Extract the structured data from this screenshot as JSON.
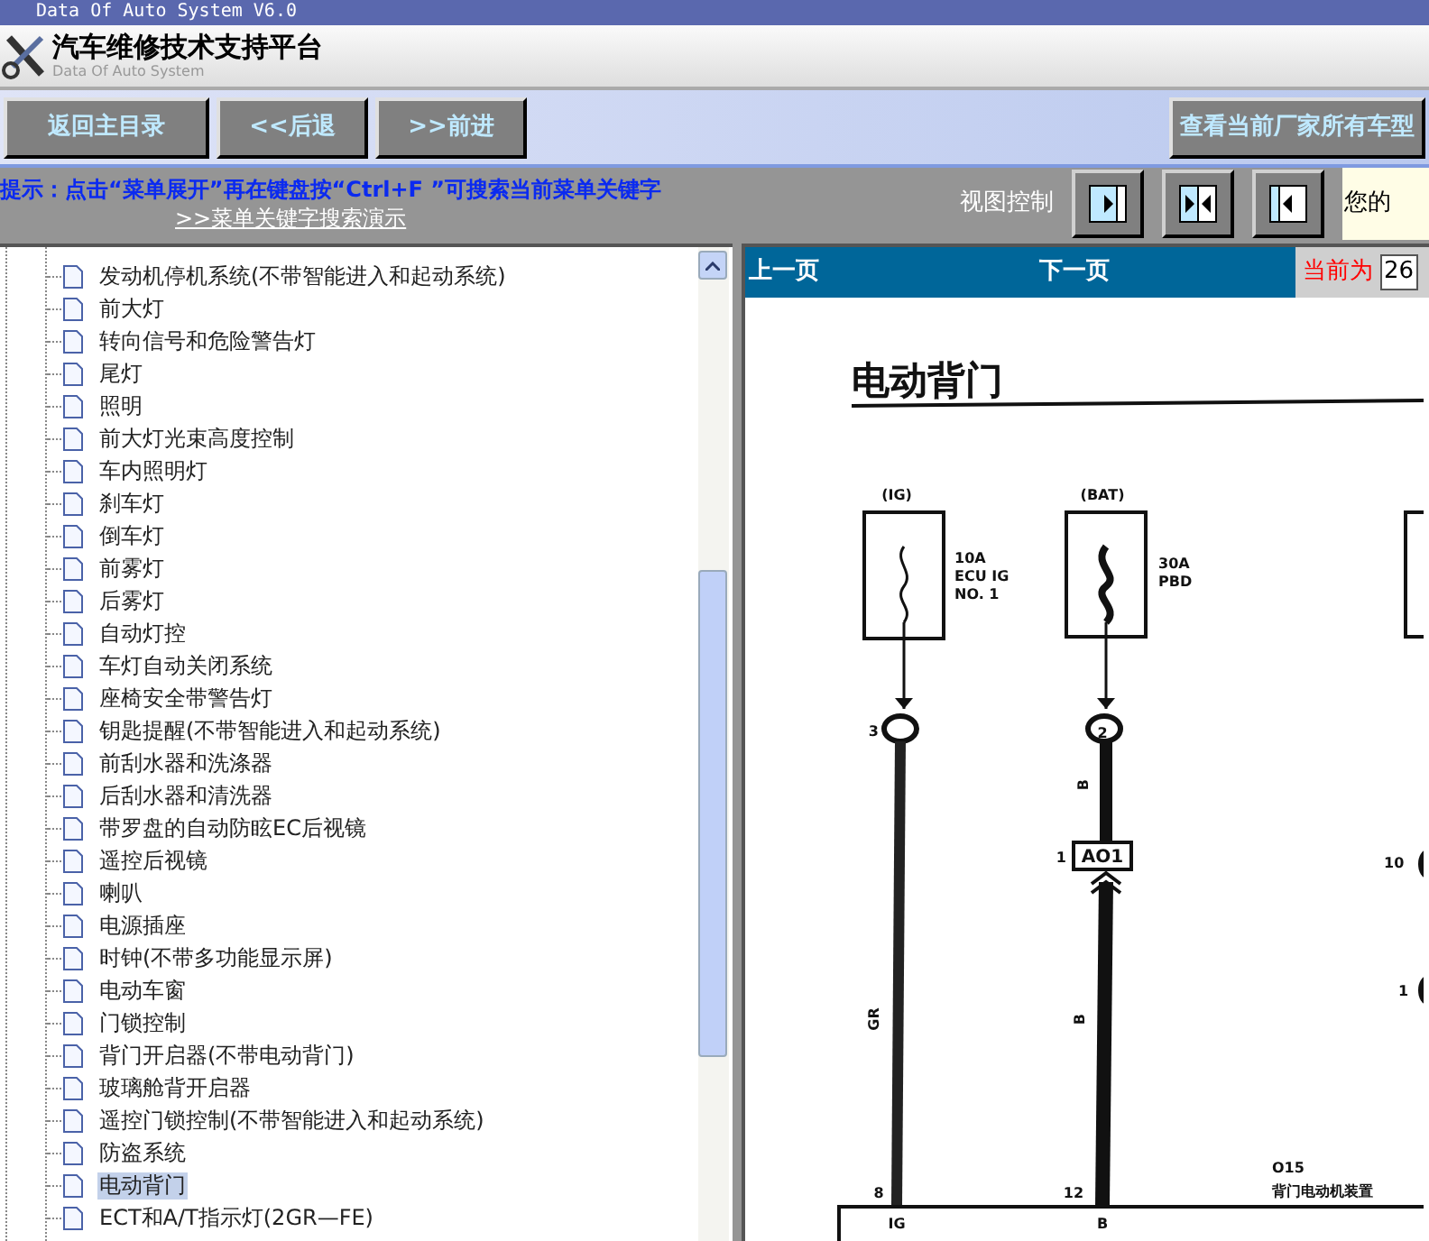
{
  "window": {
    "title": "Data Of Auto System V6.0"
  },
  "header": {
    "title": "汽车维修技术支持平台",
    "subtitle": "Data Of Auto System"
  },
  "nav_buttons": [
    "返回主目录",
    "<<后退",
    ">>前进"
  ],
  "models_button": "查看当前厂家所有车型",
  "hint": {
    "text": "提示：点击“菜单展开”再在键盘按“Ctrl+F ”可搜索当前菜单关键字",
    "link": ">>菜单关键字搜索演示"
  },
  "view_control": {
    "label": "视图控制",
    "buttons": [
      {
        "kind": "left"
      },
      {
        "kind": "split"
      },
      {
        "kind": "right"
      }
    ]
  },
  "user_box": "您的",
  "tree": [
    {
      "label": "发动机停机系统(不带智能进入和起动系统)",
      "selected": false
    },
    {
      "label": "前大灯",
      "selected": false
    },
    {
      "label": "转向信号和危险警告灯",
      "selected": false
    },
    {
      "label": "尾灯",
      "selected": false
    },
    {
      "label": "照明",
      "selected": false
    },
    {
      "label": "前大灯光束高度控制",
      "selected": false
    },
    {
      "label": "车内照明灯",
      "selected": false
    },
    {
      "label": "刹车灯",
      "selected": false
    },
    {
      "label": "倒车灯",
      "selected": false
    },
    {
      "label": "前雾灯",
      "selected": false
    },
    {
      "label": "后雾灯",
      "selected": false
    },
    {
      "label": "自动灯控",
      "selected": false
    },
    {
      "label": "车灯自动关闭系统",
      "selected": false
    },
    {
      "label": "座椅安全带警告灯",
      "selected": false
    },
    {
      "label": "钥匙提醒(不带智能进入和起动系统)",
      "selected": false
    },
    {
      "label": "前刮水器和洗涤器",
      "selected": false
    },
    {
      "label": "后刮水器和清洗器",
      "selected": false
    },
    {
      "label": "带罗盘的自动防眩EC后视镜",
      "selected": false
    },
    {
      "label": "遥控后视镜",
      "selected": false
    },
    {
      "label": "喇叭",
      "selected": false
    },
    {
      "label": "电源插座",
      "selected": false
    },
    {
      "label": "时钟(不带多功能显示屏)",
      "selected": false
    },
    {
      "label": "电动车窗",
      "selected": false
    },
    {
      "label": "门锁控制",
      "selected": false
    },
    {
      "label": "背门开启器(不带电动背门)",
      "selected": false
    },
    {
      "label": "玻璃舱背开启器",
      "selected": false
    },
    {
      "label": "遥控门锁控制(不带智能进入和起动系统)",
      "selected": false
    },
    {
      "label": "防盗系统",
      "selected": false
    },
    {
      "label": "电动背门",
      "selected": true
    },
    {
      "label": "ECT和A/T指示灯(2GR—FE)",
      "selected": false
    }
  ],
  "pager": {
    "prev": "上一页",
    "next": "下一页",
    "current_label": "当前为",
    "current_value": "26"
  },
  "diagram": {
    "title": "电动背门",
    "labels": [
      "(IG)",
      "10A",
      "ECU IG",
      "NO. 1",
      "(BAT)",
      "30A",
      "PBD",
      "3",
      "2",
      "B",
      "1",
      "AO1",
      "GR",
      "B",
      "10",
      "1",
      "O15",
      "8",
      "12",
      "背门电动机装置",
      "IG",
      "B"
    ]
  }
}
